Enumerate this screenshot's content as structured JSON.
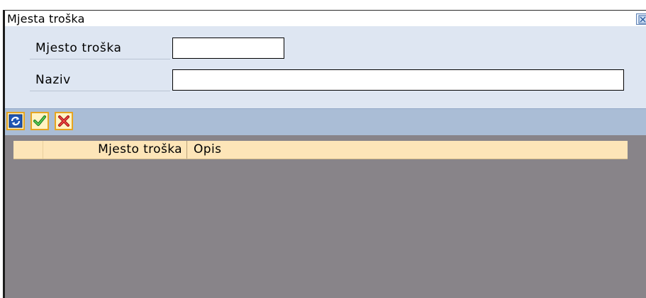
{
  "window": {
    "title": "Mjesta troška",
    "close_icon": "close-icon"
  },
  "form": {
    "fields": [
      {
        "label": "Mjesto troška",
        "value": "",
        "placeholder": ""
      },
      {
        "label": "Naziv",
        "value": "",
        "placeholder": ""
      }
    ]
  },
  "toolbar": {
    "buttons": [
      {
        "icon": "refresh-icon"
      },
      {
        "icon": "checkmark-icon"
      },
      {
        "icon": "cancel-icon"
      }
    ]
  },
  "table": {
    "columns": [
      "Mjesto troška",
      "Opis"
    ],
    "rows": []
  },
  "colors": {
    "form_background": "#dee6f2",
    "toolbar_background": "#aabdd6",
    "header_background": "#fde5b8",
    "empty_area": "#888489",
    "button_border": "#e6a521"
  }
}
